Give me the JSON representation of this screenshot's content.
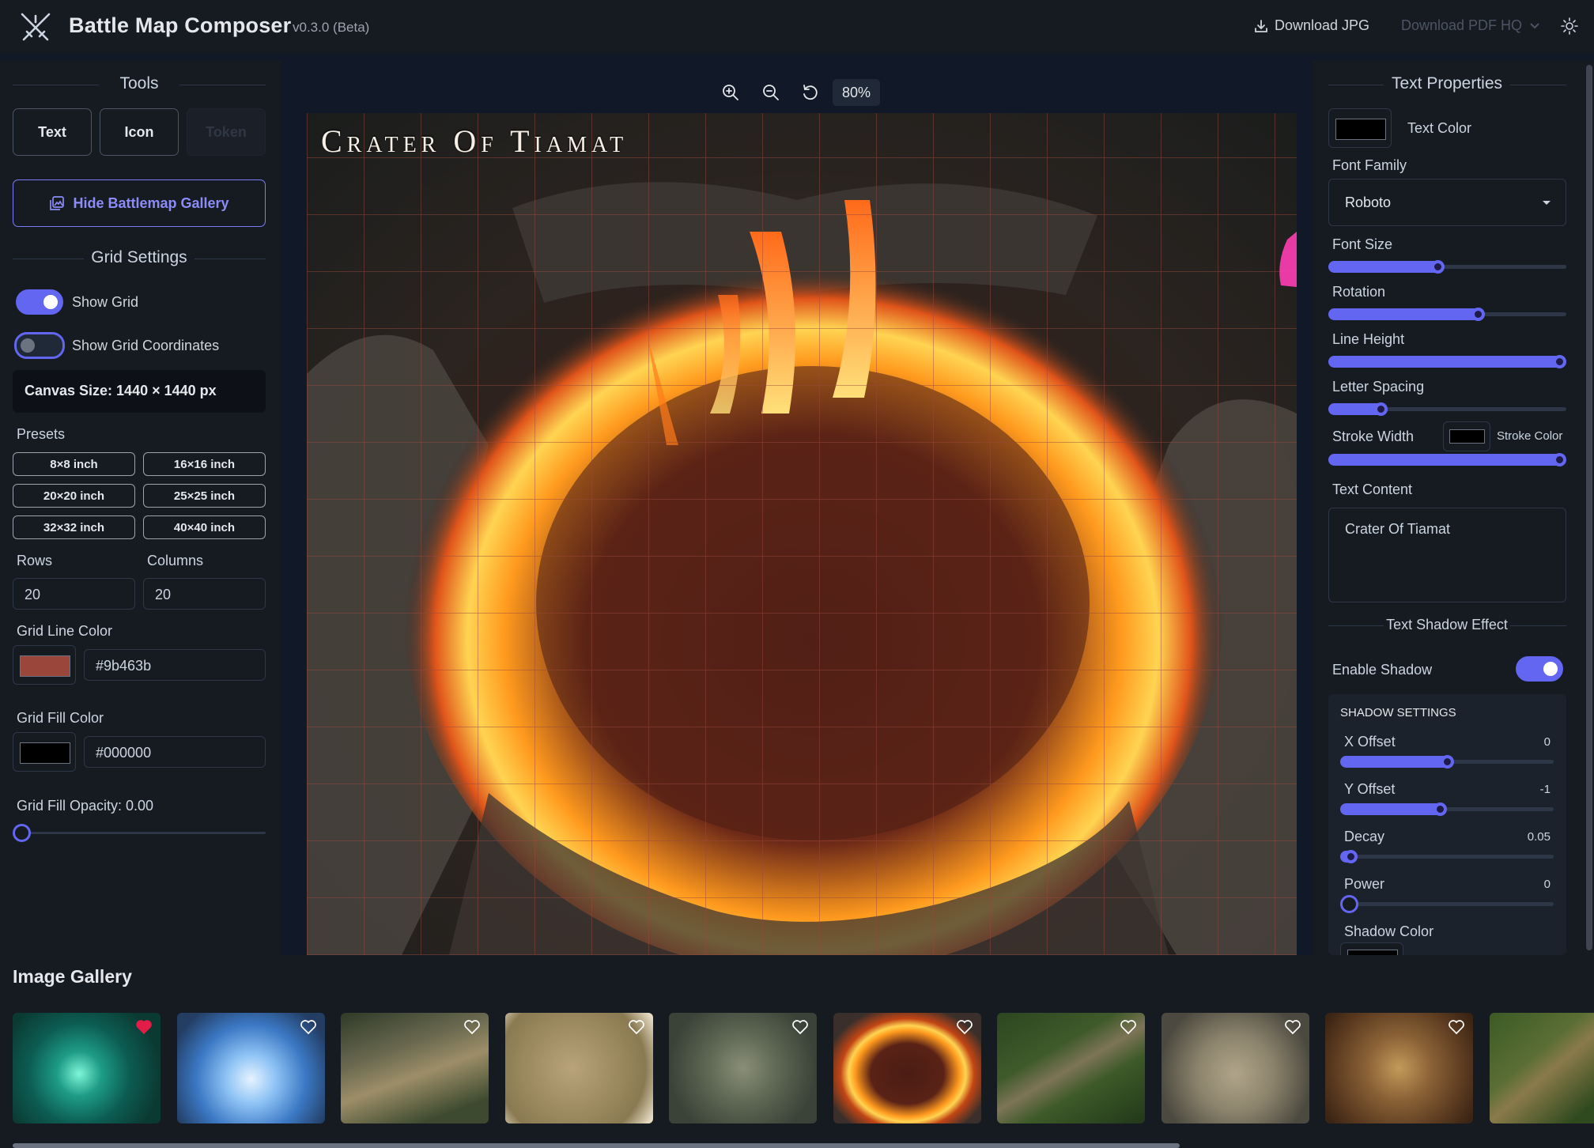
{
  "header": {
    "title": "Battle Map Composer",
    "version": "v0.3.0 (Beta)",
    "download_jpg": "Download JPG",
    "download_pdf": "Download PDF HQ"
  },
  "tools": {
    "title": "Tools",
    "text": "Text",
    "icon": "Icon",
    "token": "Token",
    "gallery_toggle": "Hide Battlemap Gallery"
  },
  "grid": {
    "title": "Grid Settings",
    "show_grid": "Show Grid",
    "show_grid_on": true,
    "show_coords": "Show Grid Coordinates",
    "show_coords_on": false,
    "canvas_size": "Canvas Size: 1440 × 1440 px",
    "presets_label": "Presets",
    "presets": [
      "8×8 inch",
      "16×16 inch",
      "20×20 inch",
      "25×25 inch",
      "32×32 inch",
      "40×40 inch"
    ],
    "rows_label": "Rows",
    "rows": "20",
    "cols_label": "Columns",
    "cols": "20",
    "line_color_label": "Grid Line Color",
    "line_color": "#9b463b",
    "fill_color_label": "Grid Fill Color",
    "fill_color": "#000000",
    "opacity_label": "Grid Fill Opacity: 0.00",
    "opacity": 0.0
  },
  "canvas": {
    "zoom": "80%",
    "map_title": "Crater Of Tiamat"
  },
  "text_props": {
    "title": "Text Properties",
    "text_color_label": "Text Color",
    "text_color": "#000000",
    "font_family_label": "Font Family",
    "font_family": "Roboto",
    "font_size_label": "Font Size",
    "font_size": 0.46,
    "rotation_label": "Rotation",
    "rotation": 0.63,
    "line_height_label": "Line Height",
    "line_height": 1.0,
    "letter_spacing_label": "Letter Spacing",
    "letter_spacing": 0.22,
    "stroke_width_label": "Stroke Width",
    "stroke_color_label": "Stroke Color",
    "stroke_color": "#000000",
    "stroke_width": 1.0,
    "text_content_label": "Text Content",
    "text_content": "Crater Of Tiamat"
  },
  "shadow": {
    "title": "Text Shadow Effect",
    "enable_label": "Enable Shadow",
    "enabled": true,
    "settings_label": "SHADOW SETTINGS",
    "x_offset_label": "X Offset",
    "x_offset": "0",
    "x_offset_pos": 0.5,
    "y_offset_label": "Y Offset",
    "y_offset": "-1",
    "y_offset_pos": 0.47,
    "decay_label": "Decay",
    "decay": "0.05",
    "decay_pos": 0.05,
    "power_label": "Power",
    "power": "0",
    "power_pos": 0.0,
    "color_label": "Shadow Color"
  },
  "gallery": {
    "title": "Image Gallery",
    "items": [
      {
        "name": "emerald-grotto",
        "favorite": true
      },
      {
        "name": "frozen-clearing",
        "favorite": false
      },
      {
        "name": "forest-ravine",
        "favorite": false
      },
      {
        "name": "village-ruins",
        "favorite": false
      },
      {
        "name": "stone-courtyard",
        "favorite": false
      },
      {
        "name": "crater-of-tiamat",
        "favorite": false
      },
      {
        "name": "forest-bridge",
        "favorite": false
      },
      {
        "name": "rocky-crossroads",
        "favorite": false
      },
      {
        "name": "ritual-hall",
        "favorite": false
      },
      {
        "name": "forest-camp",
        "favorite": false
      }
    ]
  }
}
